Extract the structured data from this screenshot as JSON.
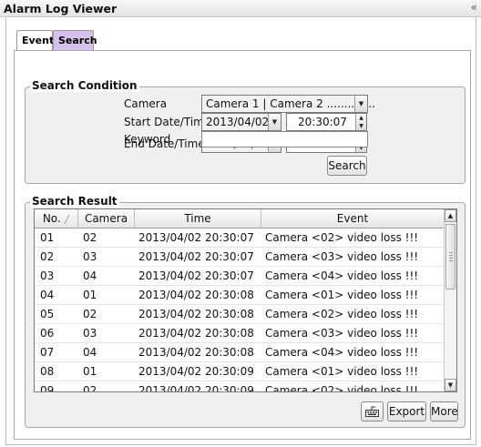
{
  "window": {
    "title": "Alarm Log Viewer",
    "collapse_icon": "«"
  },
  "tabs": [
    {
      "label": "Event",
      "active": false
    },
    {
      "label": "Search",
      "active": true,
      "color": "#d7c1ec"
    }
  ],
  "search_condition": {
    "legend": "Search Condition",
    "camera_label": "Camera",
    "camera_value": "Camera 1 | Camera 2 ..............",
    "start_label": "Start Date/Time",
    "start_date": "2013/04/02",
    "start_time": "20:30:07",
    "end_label": "End Date/Time",
    "end_date": "2013/04/02",
    "end_time": "20:32:07",
    "keyword_label": "Keyword",
    "keyword_value": "",
    "search_button": "Search"
  },
  "search_result": {
    "legend": "Search Result",
    "columns": [
      "No.",
      "Camera",
      "Time",
      "Event"
    ],
    "sort_icon": "╱",
    "rows": [
      {
        "no": "01",
        "camera": "02",
        "time": "2013/04/02 20:30:07",
        "event": "Camera <02> video loss !!!"
      },
      {
        "no": "02",
        "camera": "03",
        "time": "2013/04/02 20:30:07",
        "event": "Camera <03> video loss !!!"
      },
      {
        "no": "03",
        "camera": "04",
        "time": "2013/04/02 20:30:07",
        "event": "Camera <04> video loss !!!"
      },
      {
        "no": "04",
        "camera": "01",
        "time": "2013/04/02 20:30:08",
        "event": "Camera <01> video loss !!!"
      },
      {
        "no": "05",
        "camera": "02",
        "time": "2013/04/02 20:30:08",
        "event": "Camera <02> video loss !!!"
      },
      {
        "no": "06",
        "camera": "03",
        "time": "2013/04/02 20:30:08",
        "event": "Camera <03> video loss !!!"
      },
      {
        "no": "07",
        "camera": "04",
        "time": "2013/04/02 20:30:08",
        "event": "Camera <04> video loss !!!"
      },
      {
        "no": "08",
        "camera": "01",
        "time": "2013/04/02 20:30:09",
        "event": "Camera <01> video loss !!!"
      },
      {
        "no": "09",
        "camera": "02",
        "time": "2013/04/02 20:30:09",
        "event": "Camera <02> video loss !!!"
      }
    ]
  },
  "actions": {
    "keyboard_icon": "keyboard-icon",
    "export_button": "Export",
    "more_button": "More"
  }
}
